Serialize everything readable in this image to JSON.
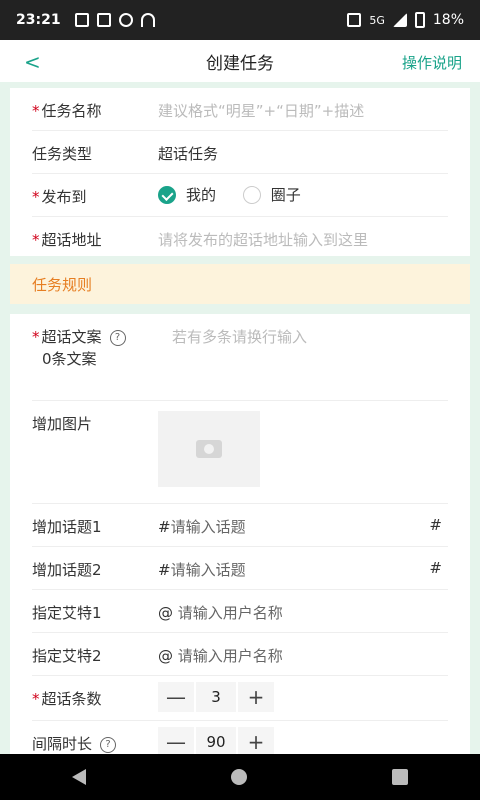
{
  "status": {
    "time": "23:21",
    "battery": "18%",
    "network": "5G"
  },
  "header": {
    "back": "<",
    "title": "创建任务",
    "help": "操作说明"
  },
  "form": {
    "task_name": {
      "label": "任务名称",
      "placeholder": "建议格式“明星”+“日期”+描述"
    },
    "task_type": {
      "label": "任务类型",
      "value": "超话任务"
    },
    "publish_to": {
      "label": "发布到",
      "options": [
        {
          "label": "我的",
          "checked": true
        },
        {
          "label": "圈子",
          "checked": false
        }
      ]
    },
    "address": {
      "label": "超话地址",
      "placeholder": "请将发布的超话地址输入到这里"
    }
  },
  "rules": {
    "title": "任务规则"
  },
  "rules_form": {
    "copy": {
      "label": "超话文案",
      "count": "0条文案",
      "placeholder": "若有多条请换行输入",
      "help": "?"
    },
    "image": {
      "label": "增加图片"
    },
    "topic1": {
      "label": "增加话题1",
      "prefix": "#",
      "placeholder": "请输入话题",
      "suffix": "#"
    },
    "topic2": {
      "label": "增加话题2",
      "prefix": "#",
      "placeholder": "请输入话题",
      "suffix": "#"
    },
    "mention1": {
      "label": "指定艾特1",
      "prefix": "@",
      "placeholder": "请输入用户名称"
    },
    "mention2": {
      "label": "指定艾特2",
      "prefix": "@",
      "placeholder": "请输入用户名称"
    },
    "count": {
      "label": "超话条数",
      "value": "3",
      "minus": "—",
      "plus": "+"
    },
    "interval": {
      "label": "间隔时长",
      "value": "90",
      "minus": "—",
      "plus": "+",
      "help": "?"
    }
  },
  "colors": {
    "accent": "#1aa38a",
    "required": "#d0021b",
    "rules_bg": "#fdf3dc",
    "rules_text": "#e67e22"
  }
}
